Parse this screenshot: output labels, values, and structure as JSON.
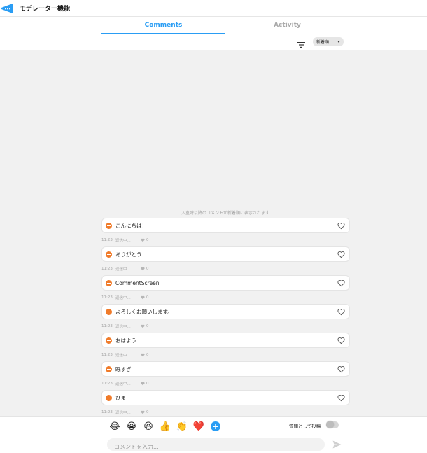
{
  "app": {
    "title": "モデレーター機能"
  },
  "tabs": [
    {
      "label": "Comments",
      "active": true
    },
    {
      "label": "Activity",
      "active": false
    }
  ],
  "sort": {
    "selected": "新着順"
  },
  "notice": "入室時以降のコメントが新着順に表示されます",
  "comments": [
    {
      "text": "こんにちは！",
      "time": "11:23",
      "status": "送信中...",
      "likes": "0"
    },
    {
      "text": "ありがとう",
      "time": "11:23",
      "status": "送信中...",
      "likes": "0"
    },
    {
      "text": "CommentScreen",
      "time": "11:23",
      "status": "送信中...",
      "likes": "0"
    },
    {
      "text": "よろしくお願いします。",
      "time": "11:23",
      "status": "送信中...",
      "likes": "0"
    },
    {
      "text": "おはよう",
      "time": "11:23",
      "status": "送信中...",
      "likes": "0"
    },
    {
      "text": "眠すぎ",
      "time": "11:23",
      "status": "送信中...",
      "likes": "0"
    },
    {
      "text": "ひま",
      "time": "11:23",
      "status": "送信中...",
      "likes": "0"
    }
  ],
  "reactions": [
    {
      "icon": "laughing-tears-icon",
      "glyph": "😂"
    },
    {
      "icon": "crying-face-icon",
      "glyph": "😭"
    },
    {
      "icon": "grinning-squint-icon",
      "glyph": "😆"
    },
    {
      "icon": "thumbs-up-icon",
      "glyph": "👍"
    },
    {
      "icon": "clapping-hands-icon",
      "glyph": "👏"
    },
    {
      "icon": "red-heart-icon",
      "glyph": "❤️"
    }
  ],
  "question_toggle": {
    "label": "質問として投稿",
    "on": false
  },
  "composer": {
    "placeholder": "コメントを入力..."
  },
  "colors": {
    "accent": "#2a9df4",
    "badge": "#f07b2a"
  }
}
